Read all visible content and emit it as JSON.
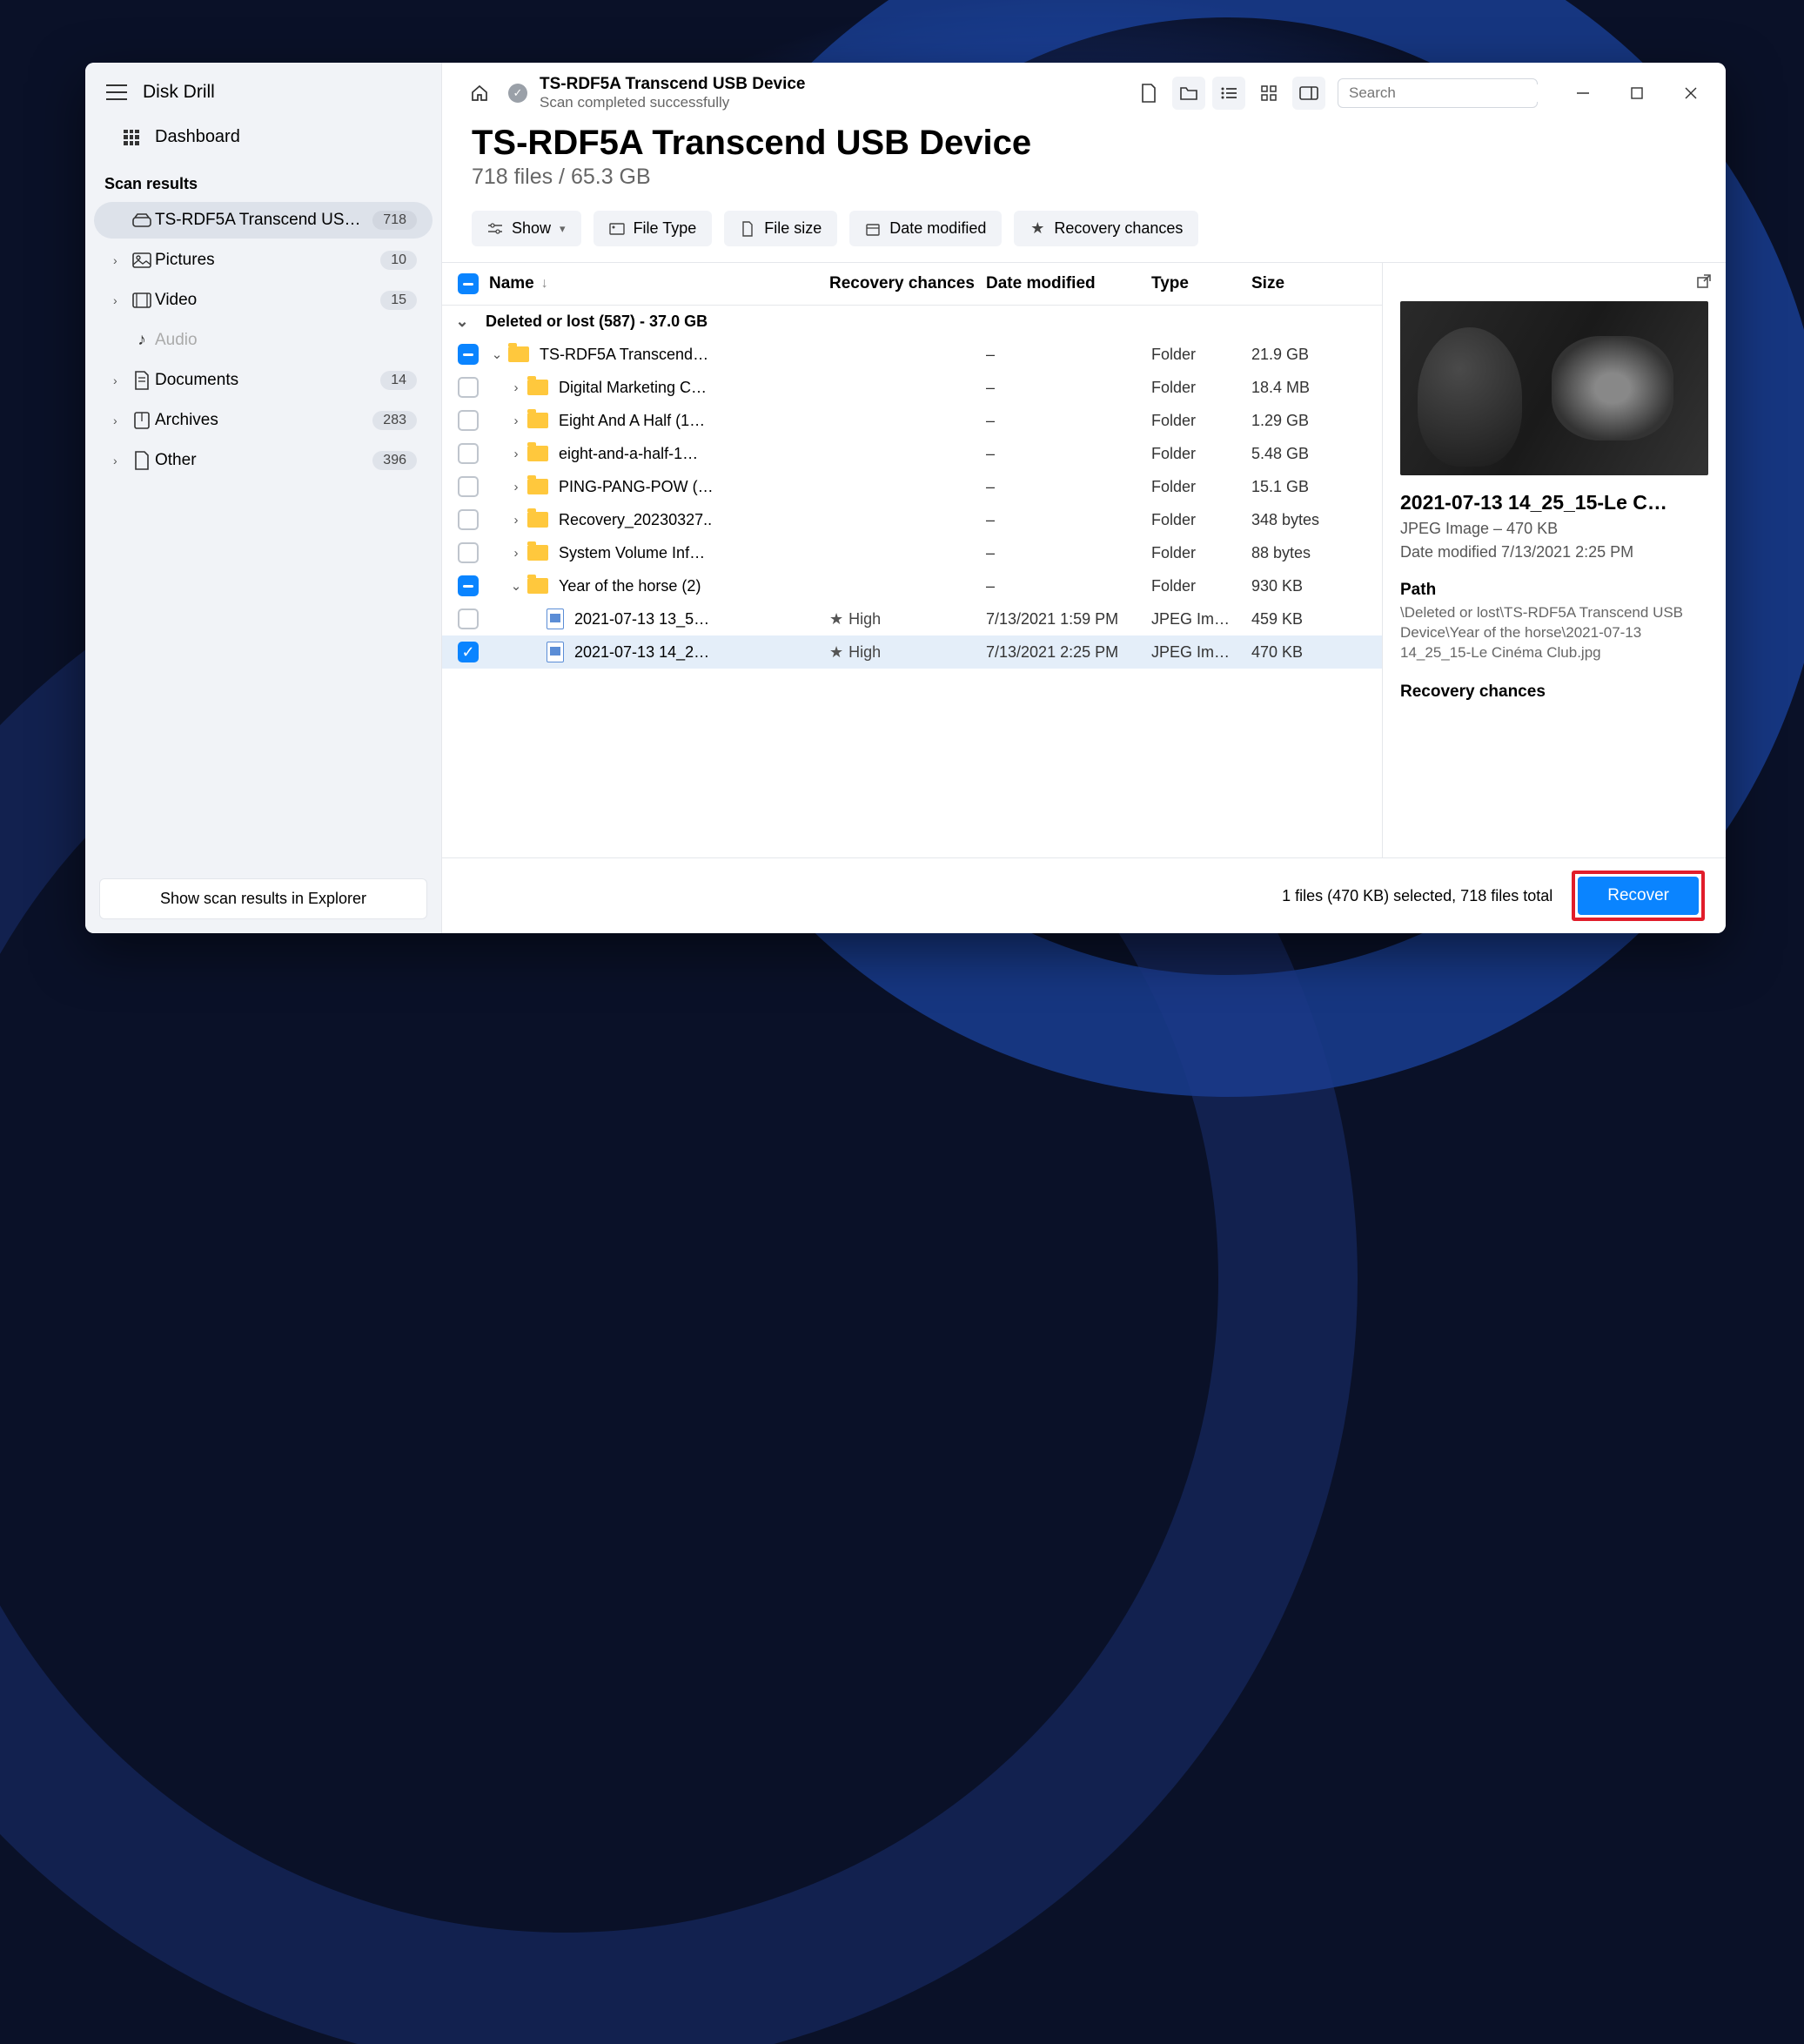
{
  "app_title": "Disk Drill",
  "sidebar": {
    "dashboard_label": "Dashboard",
    "section_label": "Scan results",
    "items": [
      {
        "label": "TS-RDF5A Transcend US…",
        "count": "718"
      },
      {
        "label": "Pictures",
        "count": "10"
      },
      {
        "label": "Video",
        "count": "15"
      },
      {
        "label": "Audio",
        "count": ""
      },
      {
        "label": "Documents",
        "count": "14"
      },
      {
        "label": "Archives",
        "count": "283"
      },
      {
        "label": "Other",
        "count": "396"
      }
    ],
    "footer_button": "Show scan results in Explorer"
  },
  "topbar": {
    "title": "TS-RDF5A Transcend USB Device",
    "subtitle": "Scan completed successfully",
    "search_placeholder": "Search"
  },
  "heading": {
    "title": "TS-RDF5A Transcend USB Device",
    "subtitle": "718 files / 65.3 GB"
  },
  "filters": {
    "show": "Show",
    "file_type": "File Type",
    "file_size": "File size",
    "date_modified": "Date modified",
    "recovery_chances": "Recovery chances"
  },
  "columns": {
    "name": "Name",
    "recovery": "Recovery chances",
    "date": "Date modified",
    "type": "Type",
    "size": "Size"
  },
  "group_label": "Deleted or lost (587) - 37.0 GB",
  "rows": [
    {
      "indent": 0,
      "exp": "down",
      "cb": "indet",
      "icon": "folder",
      "name": "TS-RDF5A Transcend…",
      "rec": "",
      "date": "–",
      "type": "Folder",
      "size": "21.9 GB"
    },
    {
      "indent": 1,
      "exp": "right",
      "cb": "empty",
      "icon": "folder",
      "name": "Digital Marketing C…",
      "rec": "",
      "date": "–",
      "type": "Folder",
      "size": "18.4 MB"
    },
    {
      "indent": 1,
      "exp": "right",
      "cb": "empty",
      "icon": "folder",
      "name": "Eight And A Half (1…",
      "rec": "",
      "date": "–",
      "type": "Folder",
      "size": "1.29 GB"
    },
    {
      "indent": 1,
      "exp": "right",
      "cb": "empty",
      "icon": "folder",
      "name": "eight-and-a-half-1…",
      "rec": "",
      "date": "–",
      "type": "Folder",
      "size": "5.48 GB"
    },
    {
      "indent": 1,
      "exp": "right",
      "cb": "empty",
      "icon": "folder",
      "name": "PING-PANG-POW (…",
      "rec": "",
      "date": "–",
      "type": "Folder",
      "size": "15.1 GB"
    },
    {
      "indent": 1,
      "exp": "right",
      "cb": "empty",
      "icon": "folder",
      "name": "Recovery_20230327..",
      "rec": "",
      "date": "–",
      "type": "Folder",
      "size": "348 bytes"
    },
    {
      "indent": 1,
      "exp": "right",
      "cb": "empty",
      "icon": "folder",
      "name": "System Volume Inf…",
      "rec": "",
      "date": "–",
      "type": "Folder",
      "size": "88 bytes"
    },
    {
      "indent": 1,
      "exp": "down",
      "cb": "indet",
      "icon": "folder",
      "name": "Year of the horse (2)",
      "rec": "",
      "date": "–",
      "type": "Folder",
      "size": "930 KB"
    },
    {
      "indent": 2,
      "exp": "",
      "cb": "empty",
      "icon": "file",
      "name": "2021-07-13 13_5…",
      "rec": "High",
      "date": "7/13/2021 1:59 PM",
      "type": "JPEG Im…",
      "size": "459 KB"
    },
    {
      "indent": 2,
      "exp": "",
      "cb": "checked",
      "icon": "file",
      "name": "2021-07-13 14_2…",
      "rec": "High",
      "date": "7/13/2021 2:25 PM",
      "type": "JPEG Im…",
      "size": "470 KB",
      "selected": true
    }
  ],
  "details": {
    "title": "2021-07-13 14_25_15-Le C…",
    "meta": "JPEG Image – 470 KB",
    "date": "Date modified 7/13/2021 2:25 PM",
    "path_heading": "Path",
    "path": "\\Deleted or lost\\TS-RDF5A Transcend USB Device\\Year of the horse\\2021-07-13 14_25_15-Le Cinéma Club.jpg",
    "rc_heading": "Recovery chances"
  },
  "statusbar": {
    "text": "1 files (470 KB) selected, 718 files total",
    "recover": "Recover"
  }
}
